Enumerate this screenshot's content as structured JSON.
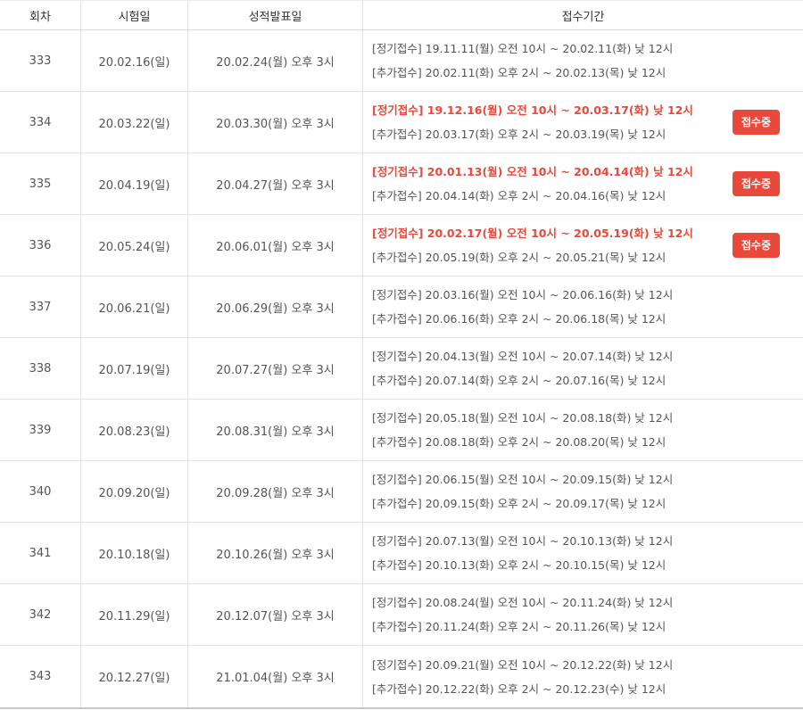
{
  "header": {
    "round": "회차",
    "exam_date": "시험일",
    "result_date": "성적발표일",
    "registration": "접수기간"
  },
  "rows": [
    {
      "round": "333",
      "exam": "20.02.16(일)",
      "result": "20.02.24(월) 오후 3시",
      "regular": "[정기접수] 19.11.11(월) 오전 10시 ~ 20.02.11(화) 낮 12시",
      "additional": "[추가접수] 20.02.11(화) 오후 2시 ~ 20.02.13(목) 낮 12시",
      "active": false,
      "badge": ""
    },
    {
      "round": "334",
      "exam": "20.03.22(일)",
      "result": "20.03.30(월) 오후 3시",
      "regular": "[정기접수] 19.12.16(월) 오전 10시 ~ 20.03.17(화) 낮 12시",
      "additional": "[추가접수] 20.03.17(화) 오후 2시 ~ 20.03.19(목) 낮 12시",
      "active": true,
      "badge": "접수중"
    },
    {
      "round": "335",
      "exam": "20.04.19(일)",
      "result": "20.04.27(월) 오후 3시",
      "regular": "[정기접수] 20.01.13(월) 오전 10시 ~ 20.04.14(화) 낮 12시",
      "additional": "[추가접수] 20.04.14(화) 오후 2시 ~ 20.04.16(목) 낮 12시",
      "active": true,
      "badge": "접수중"
    },
    {
      "round": "336",
      "exam": "20.05.24(일)",
      "result": "20.06.01(월) 오후 3시",
      "regular": "[정기접수] 20.02.17(월) 오전 10시 ~ 20.05.19(화) 낮 12시",
      "additional": "[추가접수] 20.05.19(화) 오후 2시 ~ 20.05.21(목) 낮 12시",
      "active": true,
      "badge": "접수중"
    },
    {
      "round": "337",
      "exam": "20.06.21(일)",
      "result": "20.06.29(월) 오후 3시",
      "regular": "[정기접수] 20.03.16(월) 오전 10시 ~ 20.06.16(화) 낮 12시",
      "additional": "[추가접수] 20.06.16(화) 오후 2시 ~ 20.06.18(목) 낮 12시",
      "active": false,
      "badge": ""
    },
    {
      "round": "338",
      "exam": "20.07.19(일)",
      "result": "20.07.27(월) 오후 3시",
      "regular": "[정기접수] 20.04.13(월) 오전 10시 ~ 20.07.14(화) 낮 12시",
      "additional": "[추가접수] 20.07.14(화) 오후 2시 ~ 20.07.16(목) 낮 12시",
      "active": false,
      "badge": ""
    },
    {
      "round": "339",
      "exam": "20.08.23(일)",
      "result": "20.08.31(월) 오후 3시",
      "regular": "[정기접수] 20.05.18(월) 오전 10시 ~ 20.08.18(화) 낮 12시",
      "additional": "[추가접수] 20.08.18(화) 오후 2시 ~ 20.08.20(목) 낮 12시",
      "active": false,
      "badge": ""
    },
    {
      "round": "340",
      "exam": "20.09.20(일)",
      "result": "20.09.28(월) 오후 3시",
      "regular": "[정기접수] 20.06.15(월) 오전 10시 ~ 20.09.15(화) 낮 12시",
      "additional": "[추가접수] 20.09.15(화) 오후 2시 ~ 20.09.17(목) 낮 12시",
      "active": false,
      "badge": ""
    },
    {
      "round": "341",
      "exam": "20.10.18(일)",
      "result": "20.10.26(월) 오후 3시",
      "regular": "[정기접수] 20.07.13(월) 오전 10시 ~ 20.10.13(화) 낮 12시",
      "additional": "[추가접수] 20.10.13(화) 오후 2시 ~ 20.10.15(목) 낮 12시",
      "active": false,
      "badge": ""
    },
    {
      "round": "342",
      "exam": "20.11.29(일)",
      "result": "20.12.07(월) 오후 3시",
      "regular": "[정기접수] 20.08.24(월) 오전 10시 ~ 20.11.24(화) 낮 12시",
      "additional": "[추가접수] 20.11.24(화) 오후 2시 ~ 20.11.26(목) 낮 12시",
      "active": false,
      "badge": ""
    },
    {
      "round": "343",
      "exam": "20.12.27(일)",
      "result": "21.01.04(월) 오후 3시",
      "regular": "[정기접수] 20.09.21(월) 오전 10시 ~ 20.12.22(화) 낮 12시",
      "additional": "[추가접수] 20.12.22(화) 오후 2시 ~ 20.12.23(수) 낮 12시",
      "active": false,
      "badge": ""
    }
  ],
  "colors": {
    "accent": "#e8493a",
    "text": "#555555",
    "border": "#e3e3e3"
  }
}
